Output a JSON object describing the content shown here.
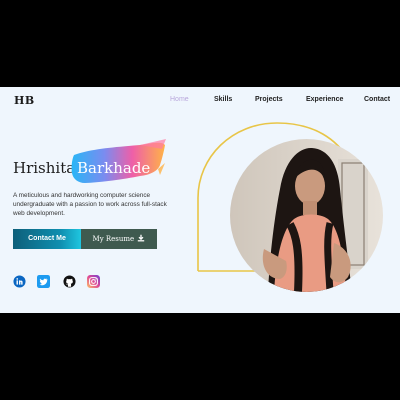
{
  "header": {
    "logo": "HB",
    "nav": [
      {
        "label": "Home",
        "active": true
      },
      {
        "label": "Skills",
        "active": false
      },
      {
        "label": "Projects",
        "active": false
      },
      {
        "label": "Experience",
        "active": false
      },
      {
        "label": "Contact",
        "active": false
      }
    ]
  },
  "hero": {
    "first_name": "Hrishita",
    "last_name": "Barkhade",
    "tagline": "A meticulous and hardworking computer science undergraduate with a passion to work across full-stack web development.",
    "contact_button": "Contact Me",
    "resume_button": "My Resume",
    "resume_icon": "download-icon"
  },
  "socials": [
    {
      "name": "linkedin-icon",
      "color": "#0a66c2"
    },
    {
      "name": "twitter-icon",
      "color": "#1d9bf0"
    },
    {
      "name": "github-icon",
      "color": "#111111"
    },
    {
      "name": "instagram-icon",
      "color": "#d6249f"
    }
  ],
  "colors": {
    "background": "#eff6fd",
    "nav_active": "#b9a7dc",
    "arch_outline": "#e8c547",
    "contact_button_start": "#0d5f7a",
    "contact_button_end": "#1fc6e0",
    "resume_button": "#3f5a4f"
  }
}
